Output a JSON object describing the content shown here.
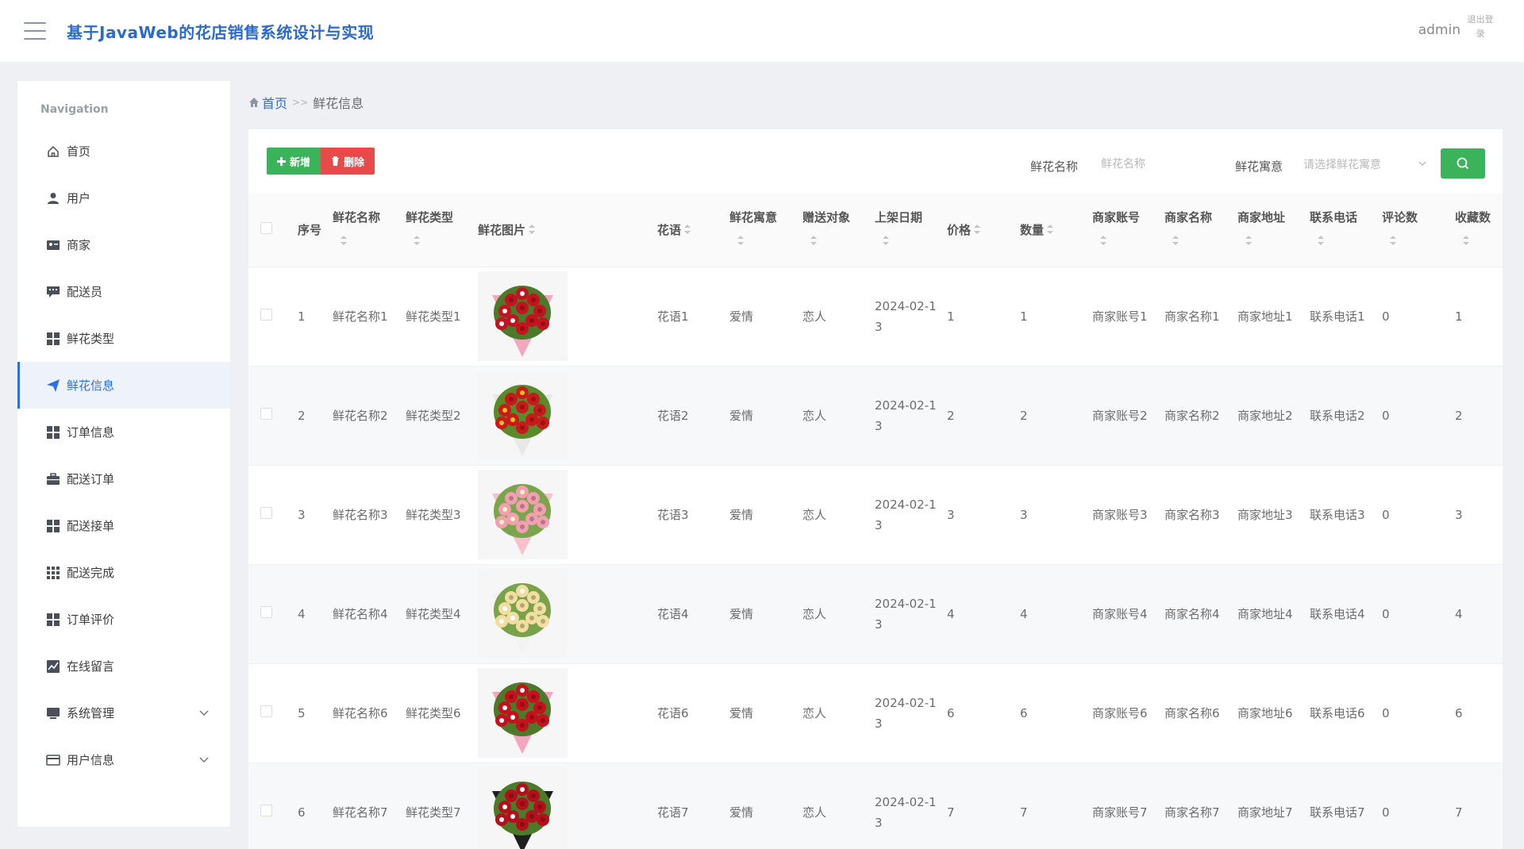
{
  "header": {
    "title": "基于JavaWeb的花店销售系统设计与实现",
    "user": "admin",
    "logout": "退出登录"
  },
  "sidebar": {
    "heading": "Navigation",
    "items": [
      {
        "label": "首页",
        "icon": "home-icon"
      },
      {
        "label": "用户",
        "icon": "user-icon"
      },
      {
        "label": "商家",
        "icon": "id-card-icon"
      },
      {
        "label": "配送员",
        "icon": "comment-icon"
      },
      {
        "label": "鲜花类型",
        "icon": "grid-icon"
      },
      {
        "label": "鲜花信息",
        "icon": "send-icon",
        "active": true
      },
      {
        "label": "订单信息",
        "icon": "grid-icon"
      },
      {
        "label": "配送订单",
        "icon": "briefcase-icon"
      },
      {
        "label": "配送接单",
        "icon": "grid-icon"
      },
      {
        "label": "配送完成",
        "icon": "apps-icon"
      },
      {
        "label": "订单评价",
        "icon": "grid-icon"
      },
      {
        "label": "在线留言",
        "icon": "chart-icon"
      },
      {
        "label": "系统管理",
        "icon": "monitor-icon",
        "expandable": true
      },
      {
        "label": "用户信息",
        "icon": "card-icon",
        "expandable": true
      }
    ]
  },
  "breadcrumb": {
    "home": "首页",
    "separator": ">>",
    "current": "鲜花信息"
  },
  "toolbar": {
    "add_label": "新增",
    "delete_label": "删除",
    "search_name_label": "鲜花名称",
    "search_name_placeholder": "鲜花名称",
    "search_meaning_label": "鲜花寓意",
    "search_meaning_placeholder": "请选择鲜花寓意"
  },
  "table": {
    "headers": [
      "序号",
      "鲜花名称",
      "鲜花类型",
      "鲜花图片",
      "花语",
      "鲜花寓意",
      "赠送对象",
      "上架日期",
      "价格",
      "数量",
      "商家账号",
      "商家名称",
      "商家地址",
      "联系电话",
      "评论数",
      "收藏数"
    ],
    "rows": [
      {
        "seq": "1",
        "name": "鲜花名称1",
        "type": "鲜花类型1",
        "image": "bouquet-red-pink-wrap",
        "language": "花语1",
        "meaning": "爱情",
        "recipient": "恋人",
        "date": "2024-02-13",
        "price": "1",
        "quantity": "1",
        "merchant_account": "商家账号1",
        "merchant_name": "商家名称1",
        "merchant_address": "商家地址1",
        "phone": "联系电话1",
        "comments": "0",
        "favorites": "1"
      },
      {
        "seq": "2",
        "name": "鲜花名称2",
        "type": "鲜花类型2",
        "image": "bouquet-red-yellow-round",
        "language": "花语2",
        "meaning": "爱情",
        "recipient": "恋人",
        "date": "2024-02-13",
        "price": "2",
        "quantity": "2",
        "merchant_account": "商家账号2",
        "merchant_name": "商家名称2",
        "merchant_address": "商家地址2",
        "phone": "联系电话2",
        "comments": "0",
        "favorites": "2"
      },
      {
        "seq": "3",
        "name": "鲜花名称3",
        "type": "鲜花类型3",
        "image": "bouquet-pink-roses",
        "language": "花语3",
        "meaning": "爱情",
        "recipient": "恋人",
        "date": "2024-02-13",
        "price": "3",
        "quantity": "3",
        "merchant_account": "商家账号3",
        "merchant_name": "商家名称3",
        "merchant_address": "商家地址3",
        "phone": "联系电话3",
        "comments": "0",
        "favorites": "3"
      },
      {
        "seq": "4",
        "name": "鲜花名称4",
        "type": "鲜花类型4",
        "image": "bouquet-champagne-roses",
        "language": "花语4",
        "meaning": "爱情",
        "recipient": "恋人",
        "date": "2024-02-13",
        "price": "4",
        "quantity": "4",
        "merchant_account": "商家账号4",
        "merchant_name": "商家名称4",
        "merchant_address": "商家地址4",
        "phone": "联系电话4",
        "comments": "0",
        "favorites": "4"
      },
      {
        "seq": "5",
        "name": "鲜花名称6",
        "type": "鲜花类型6",
        "image": "bouquet-red-pink-tall",
        "language": "花语6",
        "meaning": "爱情",
        "recipient": "恋人",
        "date": "2024-02-13",
        "price": "6",
        "quantity": "6",
        "merchant_account": "商家账号6",
        "merchant_name": "商家名称6",
        "merchant_address": "商家地址6",
        "phone": "联系电话6",
        "comments": "0",
        "favorites": "6"
      },
      {
        "seq": "6",
        "name": "鲜花名称7",
        "type": "鲜花类型7",
        "image": "bouquet-red-black-wrap",
        "language": "花语7",
        "meaning": "爱情",
        "recipient": "恋人",
        "date": "2024-02-13",
        "price": "7",
        "quantity": "7",
        "merchant_account": "商家账号7",
        "merchant_name": "商家名称7",
        "merchant_address": "商家地址7",
        "phone": "联系电话7",
        "comments": "0",
        "favorites": "7"
      }
    ]
  },
  "colors": {
    "accent": "#2f6ee0",
    "add_button": "#3bb35a",
    "delete_button": "#e84a4a",
    "search_button": "#3bb35a"
  }
}
